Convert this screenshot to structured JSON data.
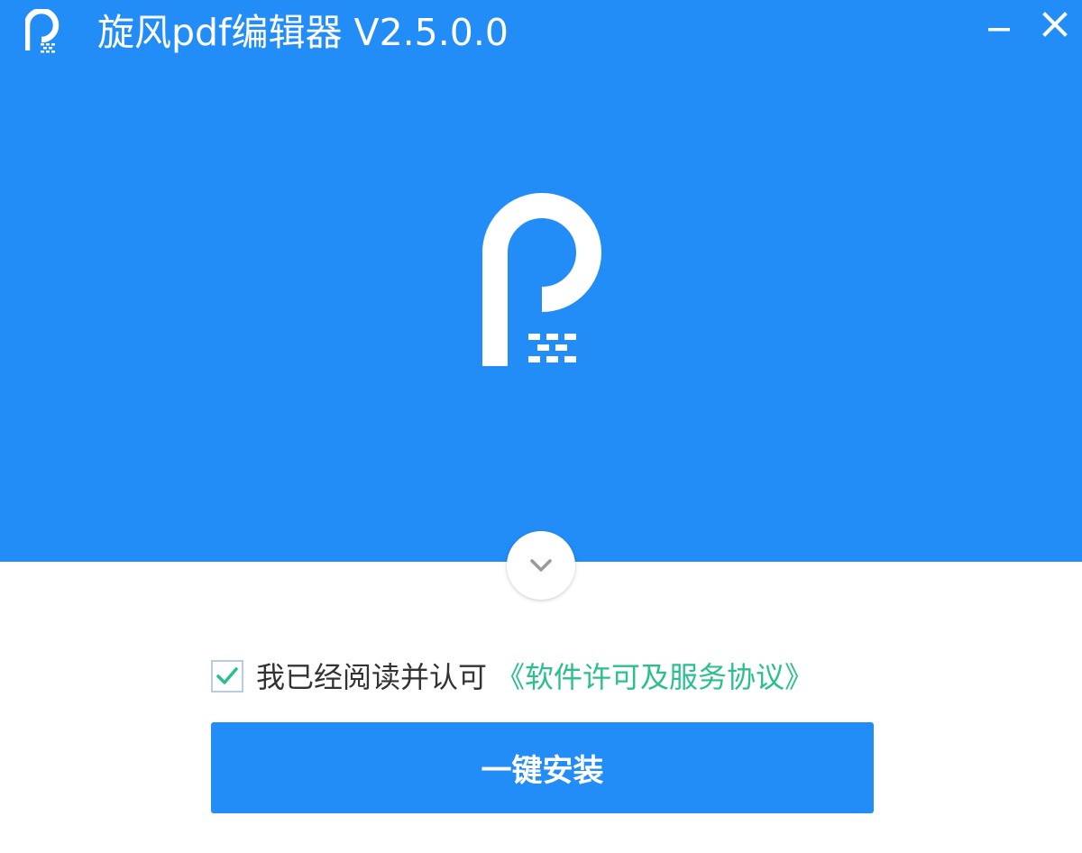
{
  "window": {
    "title": "旋风pdf编辑器 V2.5.0.0",
    "accent_color": "#238df7",
    "link_color": "#2bbf8e"
  },
  "titlebar": {
    "icons": {
      "app": "app-logo-icon",
      "minimize": "minimize-icon",
      "close": "close-icon"
    }
  },
  "hero": {
    "logo_icon": "app-logo-large-icon",
    "expand_icon": "chevron-down-icon"
  },
  "agreement": {
    "checked": true,
    "text": "我已经阅读并认可",
    "link": "《软件许可及服务协议》"
  },
  "actions": {
    "install_label": "一键安装"
  }
}
